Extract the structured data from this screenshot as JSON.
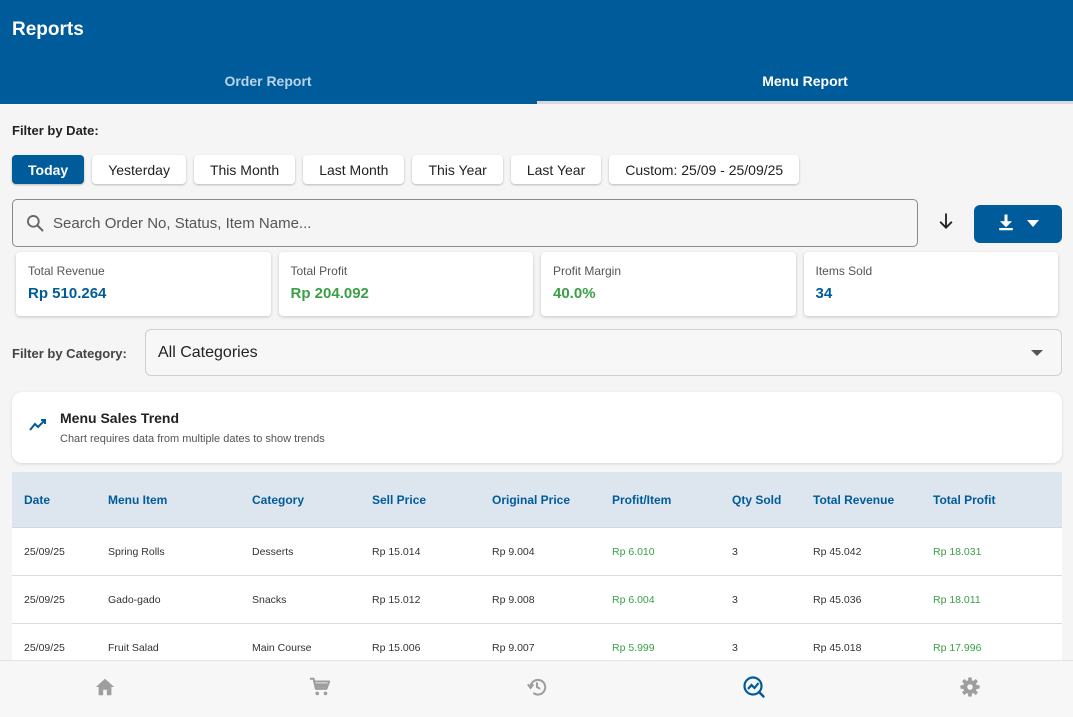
{
  "app": {
    "title": "Reports"
  },
  "tabs": [
    {
      "label": "Order Report",
      "active": false
    },
    {
      "label": "Menu Report",
      "active": true
    }
  ],
  "date_filter": {
    "label": "Filter by Date:",
    "chips": [
      "Today",
      "Yesterday",
      "This Month",
      "Last Month",
      "This Year",
      "Last Year",
      "Custom: 25/09 - 25/09/25"
    ],
    "selected": "Today"
  },
  "search": {
    "placeholder": "Search Order No, Status, Item Name...",
    "value": ""
  },
  "stats": [
    {
      "label": "Total Revenue",
      "value": "Rp 510.264",
      "color": "#005b9a"
    },
    {
      "label": "Total Profit",
      "value": "Rp 204.092",
      "color": "#3aa046"
    },
    {
      "label": "Profit Margin",
      "value": "40.0%",
      "color": "#3aa046"
    },
    {
      "label": "Items Sold",
      "value": "34",
      "color": "#005b9a"
    }
  ],
  "category_filter": {
    "label": "Filter by Category:",
    "value": "All Categories"
  },
  "trend": {
    "icon": "trending-up-icon",
    "title": "Menu Sales Trend",
    "subtitle": "Chart requires data from multiple dates to show trends"
  },
  "table": {
    "headers": [
      "Date",
      "Menu Item",
      "Category",
      "Sell Price",
      "Original Price",
      "Profit/Item",
      "Qty Sold",
      "Total Revenue",
      "Total Profit"
    ],
    "rows": [
      [
        "25/09/25",
        "Spring Rolls",
        "Desserts",
        "Rp 15.014",
        "Rp 9.004",
        "Rp 6.010",
        "3",
        "Rp 45.042",
        "Rp 18.031"
      ],
      [
        "25/09/25",
        "Gado-gado",
        "Snacks",
        "Rp 15.012",
        "Rp 9.008",
        "Rp 6.004",
        "3",
        "Rp 45.036",
        "Rp 18.011"
      ],
      [
        "25/09/25",
        "Fruit Salad",
        "Main Course",
        "Rp 15.006",
        "Rp 9.007",
        "Rp 5.999",
        "3",
        "Rp 45.018",
        "Rp 17.996"
      ]
    ]
  },
  "nav": [
    {
      "icon": "home-icon",
      "active": false
    },
    {
      "icon": "cart-icon",
      "active": false
    },
    {
      "icon": "history-icon",
      "active": false
    },
    {
      "icon": "analytics-icon",
      "active": true
    },
    {
      "icon": "settings-icon",
      "active": false
    }
  ],
  "colors": {
    "primary": "#005b9a",
    "positive": "#3aa046",
    "inactive_nav": "#9e9e9e"
  }
}
